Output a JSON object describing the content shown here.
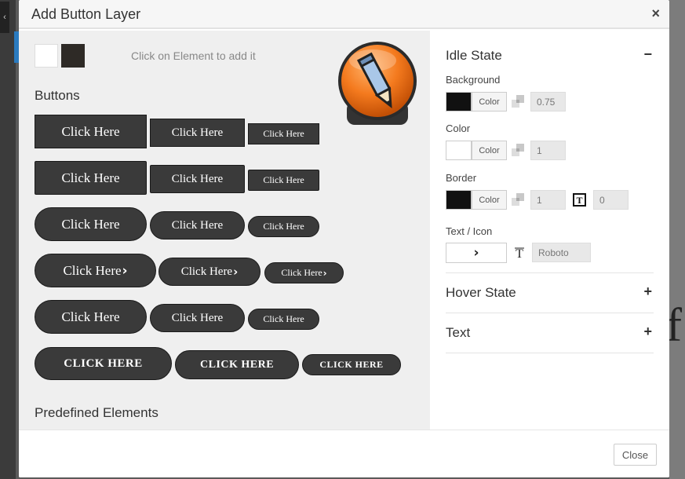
{
  "modal": {
    "title": "Add Button Layer",
    "close_icon": "×",
    "footer_close_label": "Close"
  },
  "left_panel": {
    "hint": "Click on Element to add it",
    "buttons_title": "Buttons",
    "predefined_title": "Predefined Elements",
    "button_label": "Click Here",
    "button_label_caps": "CLICK HERE",
    "chevron_glyph": "›",
    "swatches": [
      {
        "name": "white-swatch",
        "color": "#ffffff"
      },
      {
        "name": "dark-swatch",
        "color": "#2e2a26"
      }
    ],
    "editor_icon": "pencil-icon"
  },
  "right_panel": {
    "idle_title": "Idle State",
    "idle_toggle": "−",
    "background_label": "Background",
    "background_color": "#111111",
    "background_color_btn": "Color",
    "background_opacity": "0.75",
    "color_label": "Color",
    "color_color": "#ffffff",
    "color_color_btn": "Color",
    "color_opacity": "1",
    "border_label": "Border",
    "border_color": "#111111",
    "border_color_btn": "Color",
    "border_opacity": "1",
    "border_width": "0",
    "text_icon_label": "Text / Icon",
    "text_icon_glyph": "›",
    "font_value": "Roboto",
    "hover_title": "Hover State",
    "hover_toggle": "+",
    "text_title": "Text",
    "text_toggle": "+"
  }
}
